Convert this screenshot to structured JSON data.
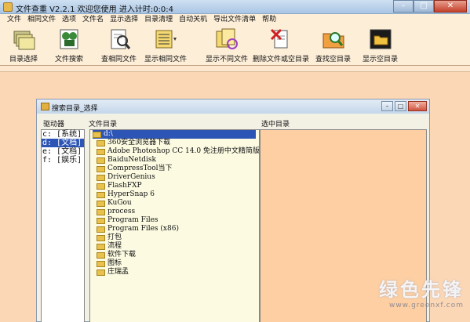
{
  "window": {
    "title": "文件查重 V2.2.1     欢迎您使用    进入计时:0:0:4",
    "minimize": "–",
    "maximize": "□",
    "close": "✕"
  },
  "menu": [
    "文件",
    "相同文件",
    "选项",
    "文件名",
    "显示选择",
    "目录清理",
    "自动关机",
    "导出文件清单",
    "帮助"
  ],
  "toolbar": [
    {
      "label": "目录选择",
      "icon": "folders-icon"
    },
    {
      "label": "文件搜索",
      "icon": "binoculars-icon"
    },
    {
      "label": "查相同文件",
      "icon": "magnifier-document-icon"
    },
    {
      "label": "显示相同文件",
      "icon": "list-documents-icon"
    },
    {
      "label": "显示不同文件",
      "icon": "compare-documents-icon"
    },
    {
      "label": "删除文件或空目录",
      "icon": "delete-document-icon"
    },
    {
      "label": "查找空目录",
      "icon": "search-folder-icon"
    },
    {
      "label": "显示空目录",
      "icon": "empty-folder-icon"
    }
  ],
  "dialog": {
    "title": "搜索目录_选择",
    "headers": {
      "drives": "驱动器",
      "folders": "文件目录",
      "selected": "选中目录"
    },
    "drives": [
      {
        "label": "c: [系统]",
        "selected": false
      },
      {
        "label": "d: [文档]",
        "selected": true
      },
      {
        "label": "e: [文档]",
        "selected": false
      },
      {
        "label": "f: [娱乐]",
        "selected": false
      }
    ],
    "root": "d:\\",
    "folders": [
      "360安全浏览器下载",
      "Adobe Photoshop CC 14.0 免注册中文精简版",
      "BaiduNetdisk",
      "CompressTool当下",
      "DriverGenius",
      "FlashFXP",
      "HyperSnap 6",
      "KuGou",
      "process",
      "Program Files",
      "Program Files (x86)",
      "打包",
      "流程",
      "软件下载",
      "图标",
      "庄瑞孟"
    ]
  },
  "watermark": {
    "main": "绿色先锋",
    "sub": "www.greenxf.com"
  }
}
